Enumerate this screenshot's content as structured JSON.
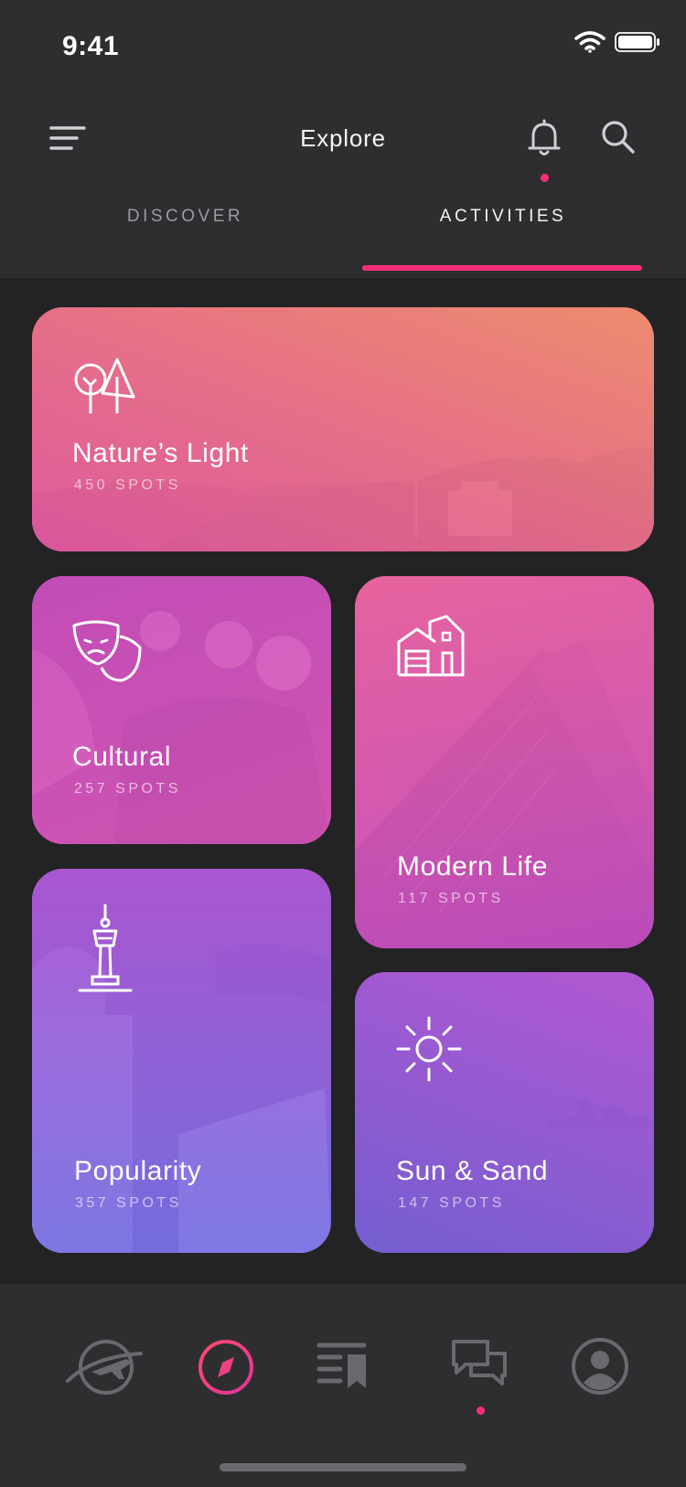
{
  "status_bar": {
    "time": "9:41"
  },
  "header": {
    "title": "Explore"
  },
  "tabs": [
    {
      "label": "DISCOVER",
      "active": false
    },
    {
      "label": "ACTIVITIES",
      "active": true
    }
  ],
  "accent_color": "#ff2d7a",
  "cards": [
    {
      "title": "Nature’s Light",
      "count": "450 SPOTS",
      "icon": "trees-icon"
    },
    {
      "title": "Cultural",
      "count": "257 SPOTS",
      "icon": "theater-masks-icon"
    },
    {
      "title": "Modern Life",
      "count": "117 SPOTS",
      "icon": "building-icon"
    },
    {
      "title": "Popularity",
      "count": "357 SPOTS",
      "icon": "tower-icon"
    },
    {
      "title": "Sun & Sand",
      "count": "147 SPOTS",
      "icon": "sun-icon"
    }
  ],
  "bottom_nav": [
    {
      "icon": "travel-planet-icon",
      "active": false
    },
    {
      "icon": "compass-icon",
      "active": true
    },
    {
      "icon": "bookmark-list-icon",
      "active": false
    },
    {
      "icon": "chat-icon",
      "active": false,
      "badge": true
    },
    {
      "icon": "profile-icon",
      "active": false
    }
  ]
}
